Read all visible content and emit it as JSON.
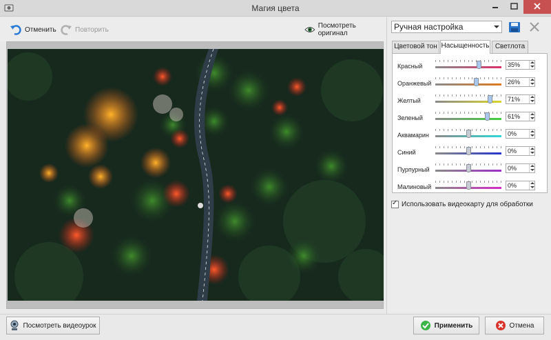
{
  "window": {
    "title": "Магия цвета"
  },
  "toolbar": {
    "undo_label": "Отменить",
    "redo_label": "Повторить",
    "preview_label": "Посмотреть оригинал"
  },
  "panel": {
    "preset": "Ручная настройка",
    "tabs": [
      {
        "label": "Цветовой тон",
        "active": false
      },
      {
        "label": "Насыщенность",
        "active": true
      },
      {
        "label": "Светлота",
        "active": false
      }
    ],
    "sliders": [
      {
        "label": "Красный",
        "value": "35%",
        "level": 0.35,
        "color": "#d8326a"
      },
      {
        "label": "Оранжевый",
        "value": "26%",
        "level": 0.26,
        "color": "#e0791e"
      },
      {
        "label": "Желтый",
        "value": "71%",
        "level": 0.71,
        "color": "#d9d52a"
      },
      {
        "label": "Зеленый",
        "value": "61%",
        "level": 0.61,
        "color": "#3fcf3c"
      },
      {
        "label": "Аквамарин",
        "value": "0%",
        "level": 0.0,
        "color": "#2fd6d6"
      },
      {
        "label": "Синий",
        "value": "0%",
        "level": 0.0,
        "color": "#2536c9"
      },
      {
        "label": "Пурпурный",
        "value": "0%",
        "level": 0.0,
        "color": "#9b2fc4"
      },
      {
        "label": "Малиновый",
        "value": "0%",
        "level": 0.0,
        "color": "#d12cc4"
      }
    ],
    "gpu_label": "Использовать видеокарту для обработки",
    "gpu_checked": true
  },
  "bottom": {
    "video_label": "Посмотреть видеоурок",
    "apply_label": "Применить",
    "cancel_label": "Отмена"
  },
  "icons": {
    "undo": "undo-arrow-icon",
    "redo": "redo-arrow-icon",
    "preview": "eye-icon",
    "save": "floppy-disk-icon",
    "delete": "close-x-icon",
    "video": "webcam-icon",
    "apply": "green-check-icon",
    "cancel": "red-x-icon"
  }
}
